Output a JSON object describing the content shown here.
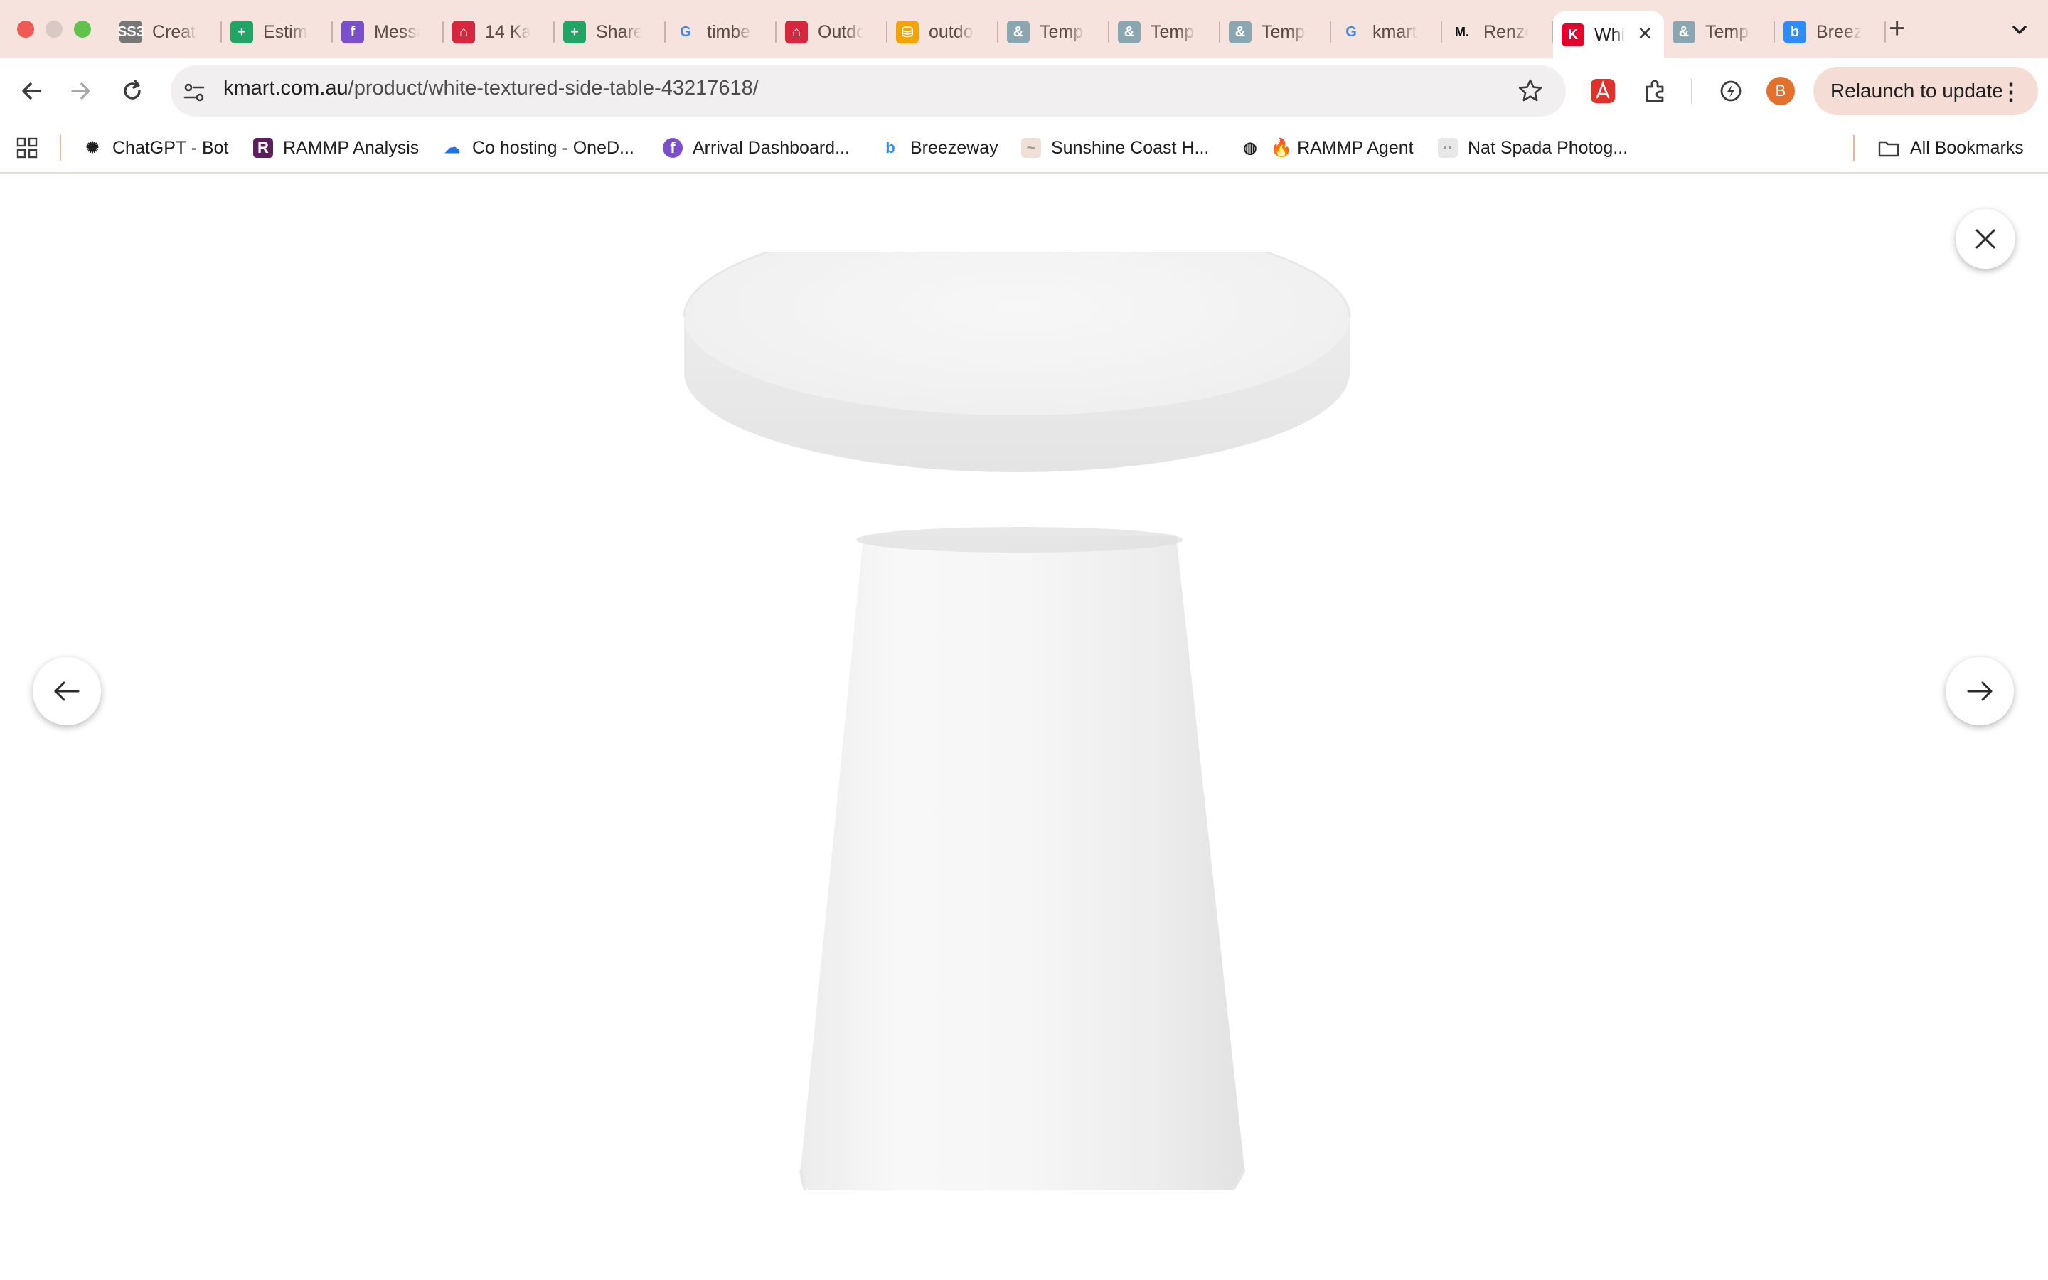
{
  "browser": {
    "tabs": [
      {
        "title": "Create",
        "icon": "ss3-icon",
        "color": "#777777",
        "glyph": "SS3"
      },
      {
        "title": "Estimate",
        "icon": "sheets-icon",
        "color": "#21a464",
        "glyph": "+"
      },
      {
        "title": "Messages",
        "icon": "purple-app-icon",
        "color": "#7b4fc9",
        "glyph": "f"
      },
      {
        "title": "14 Ka",
        "icon": "home-icon",
        "color": "#d7263d",
        "glyph": "⌂"
      },
      {
        "title": "Share",
        "icon": "sheets-icon",
        "color": "#21a464",
        "glyph": "+"
      },
      {
        "title": "timber",
        "icon": "google-icon",
        "color": "#ffffff",
        "glyph": "G"
      },
      {
        "title": "Outdoor",
        "icon": "chair-icon",
        "color": "#d7263d",
        "glyph": "⌂"
      },
      {
        "title": "outdoor",
        "icon": "shopping-icon",
        "color": "#f4a400",
        "glyph": "⛁"
      },
      {
        "title": "Temp",
        "icon": "ampersand-icon",
        "color": "#8aa6b0",
        "glyph": "&"
      },
      {
        "title": "Temp",
        "icon": "ampersand-icon",
        "color": "#8aa6b0",
        "glyph": "&"
      },
      {
        "title": "Temp",
        "icon": "ampersand-icon",
        "color": "#8aa6b0",
        "glyph": "&"
      },
      {
        "title": "kmart",
        "icon": "google-icon",
        "color": "#ffffff",
        "glyph": "G"
      },
      {
        "title": "Renzo",
        "icon": "m-logo-icon",
        "color": "#ffffff",
        "glyph": "M."
      },
      {
        "title": "White",
        "icon": "kmart-icon",
        "color": "#e4002b",
        "glyph": "K",
        "active": true
      },
      {
        "title": "Temp",
        "icon": "ampersand-icon",
        "color": "#8aa6b0",
        "glyph": "&"
      },
      {
        "title": "Breezeway",
        "icon": "breezeway-icon",
        "color": "#2d8cff",
        "glyph": "b"
      }
    ],
    "url_host": "kmart.com.au",
    "url_path": "/product/white-textured-side-table-43217618/",
    "avatar_letter": "B",
    "relaunch_label": "Relaunch to update",
    "bookmarks": [
      {
        "label": "ChatGPT - Bot",
        "icon": "chatgpt-icon",
        "color": "#1f1f1f",
        "glyph": "✺"
      },
      {
        "label": "RAMMP Analysis",
        "icon": "rammp-icon",
        "color": "#5b1f5e",
        "glyph": "R"
      },
      {
        "label": "Co hosting - OneD...",
        "icon": "onedrive-icon",
        "color": "#1a73e8",
        "glyph": "☁"
      },
      {
        "label": "Arrival Dashboard...",
        "icon": "purple-app-icon",
        "color": "#7b4fc9",
        "glyph": "f"
      },
      {
        "label": "Breezeway",
        "icon": "breezeway-icon",
        "color": "#2d8cff",
        "glyph": "b"
      },
      {
        "label": "Sunshine Coast H...",
        "icon": "generic-page-icon",
        "color": "#f0e0d8",
        "glyph": "~"
      },
      {
        "label": "🔥 RAMMP Agent",
        "icon": "globe-icon",
        "color": "#1f1f1f",
        "glyph": "◍"
      },
      {
        "label": "Nat Spada Photog...",
        "icon": "generic-page-icon",
        "color": "#e8e8e8",
        "glyph": "··"
      }
    ],
    "all_bookmarks_label": "All Bookmarks"
  },
  "viewer": {
    "product_image": "white-textured-side-table"
  }
}
